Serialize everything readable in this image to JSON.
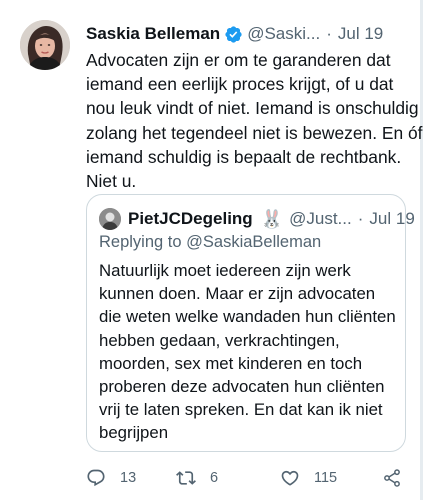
{
  "tweet": {
    "author_name": "Saskia Belleman",
    "author_handle": "@Saski...",
    "date": "Jul 19",
    "text_lines": [
      "Advocaten zijn er om te garanderen dat",
      "iemand een eerlijk proces krijgt, of u dat",
      "nou leuk vindt of niet. Iemand is onschuldig",
      "zolang het tegendeel niet is bewezen. En óf",
      "iemand schuldig is bepaalt de rechtbank.",
      "Niet u."
    ]
  },
  "quoted": {
    "author_name": "PietJCDegeling",
    "author_emoji": "🐰",
    "author_handle": "@Just...",
    "date": "Jul 19",
    "replying_prefix": "Replying to ",
    "replying_handle": "@SaskiaBelleman",
    "text_lines": [
      "Natuurlijk moet iedereen zijn werk",
      "kunnen doen. Maar er zijn advocaten",
      "die weten welke wandaden hun cliënten",
      "hebben gedaan, verkrachtingen,",
      "moorden, sex met kinderen en toch",
      "proberen deze advocaten hun cliënten",
      "vrij te laten spreken. En dat kan ik niet",
      "begrijpen"
    ]
  },
  "actions": {
    "reply_count": "13",
    "retweet_count": "6",
    "like_count": "115"
  },
  "icons": {
    "verified": "verified-badge-icon",
    "reply": "comment-icon",
    "retweet": "retweet-icon",
    "like": "heart-icon",
    "share": "share-icon"
  },
  "colors": {
    "verified": "#1d9bf0",
    "secondary_text": "#536471",
    "border": "#cfd9de"
  }
}
